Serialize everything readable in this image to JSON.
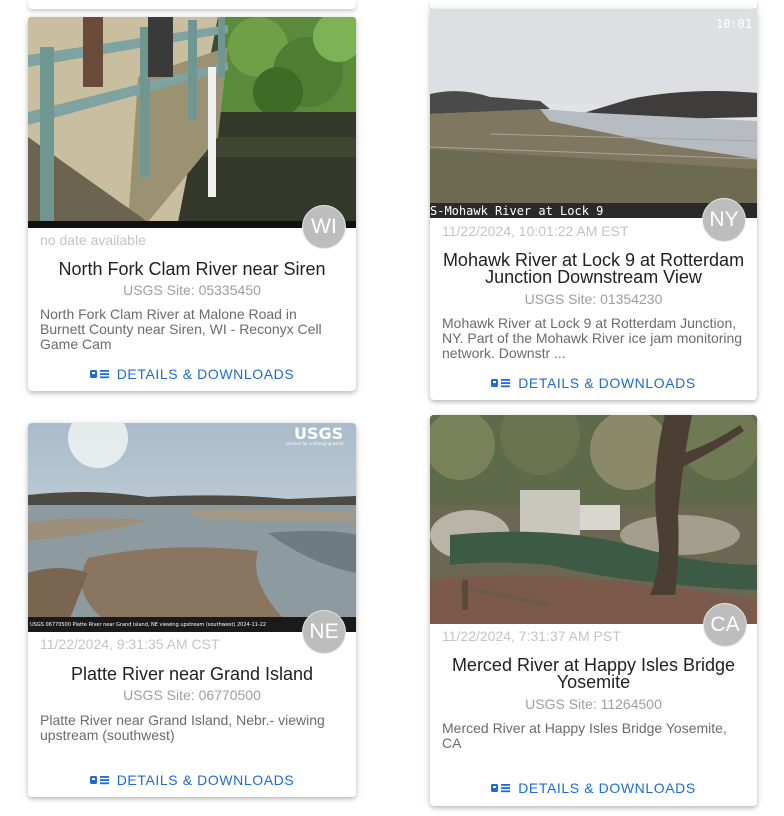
{
  "cards": [
    {
      "badge": "WI",
      "date": "no date available",
      "title": "North Fork Clam River near Siren",
      "site": "USGS Site: 05335450",
      "description": "North Fork Clam River at Malone Road in Burnett County near Siren, WI - Reconyx Cell Game Cam",
      "button": "DETAILS & DOWNLOADS"
    },
    {
      "badge": "NY",
      "date": "11/22/2024, 10:01:22 AM EST",
      "title": "Mohawk River at Lock 9 at Rotterdam Junction Downstream View",
      "site": "USGS Site: 01354230",
      "description": "Mohawk River at Lock 9 at Rotterdam Junction, NY. Part of the Mohawk River ice jam monitoring network. Downstr ...",
      "button": "DETAILS & DOWNLOADS",
      "image_caption": "S-Mohawk River at Lock 9",
      "image_time": "10:01"
    },
    {
      "badge": "NE",
      "date": "11/22/2024, 9:31:35 AM CST",
      "title": "Platte River near Grand Island",
      "site": "USGS Site: 06770500",
      "description": "Platte River near Grand Island, Nebr.- viewing upstream (southwest)",
      "button": "DETAILS & DOWNLOADS",
      "image_logo": "USGS",
      "image_logo_sub": "science for a changing world",
      "image_caption": "USGS 06770500 Platte River near Grand Island, NE viewing upstream (southwest) 2024-11-22"
    },
    {
      "badge": "CA",
      "date": "11/22/2024, 7:31:37 AM PST",
      "title": "Merced River at Happy Isles Bridge Yosemite",
      "site": "USGS Site: 11264500",
      "description": "Merced River at Happy Isles Bridge Yosemite, CA",
      "button": "DETAILS & DOWNLOADS"
    }
  ]
}
